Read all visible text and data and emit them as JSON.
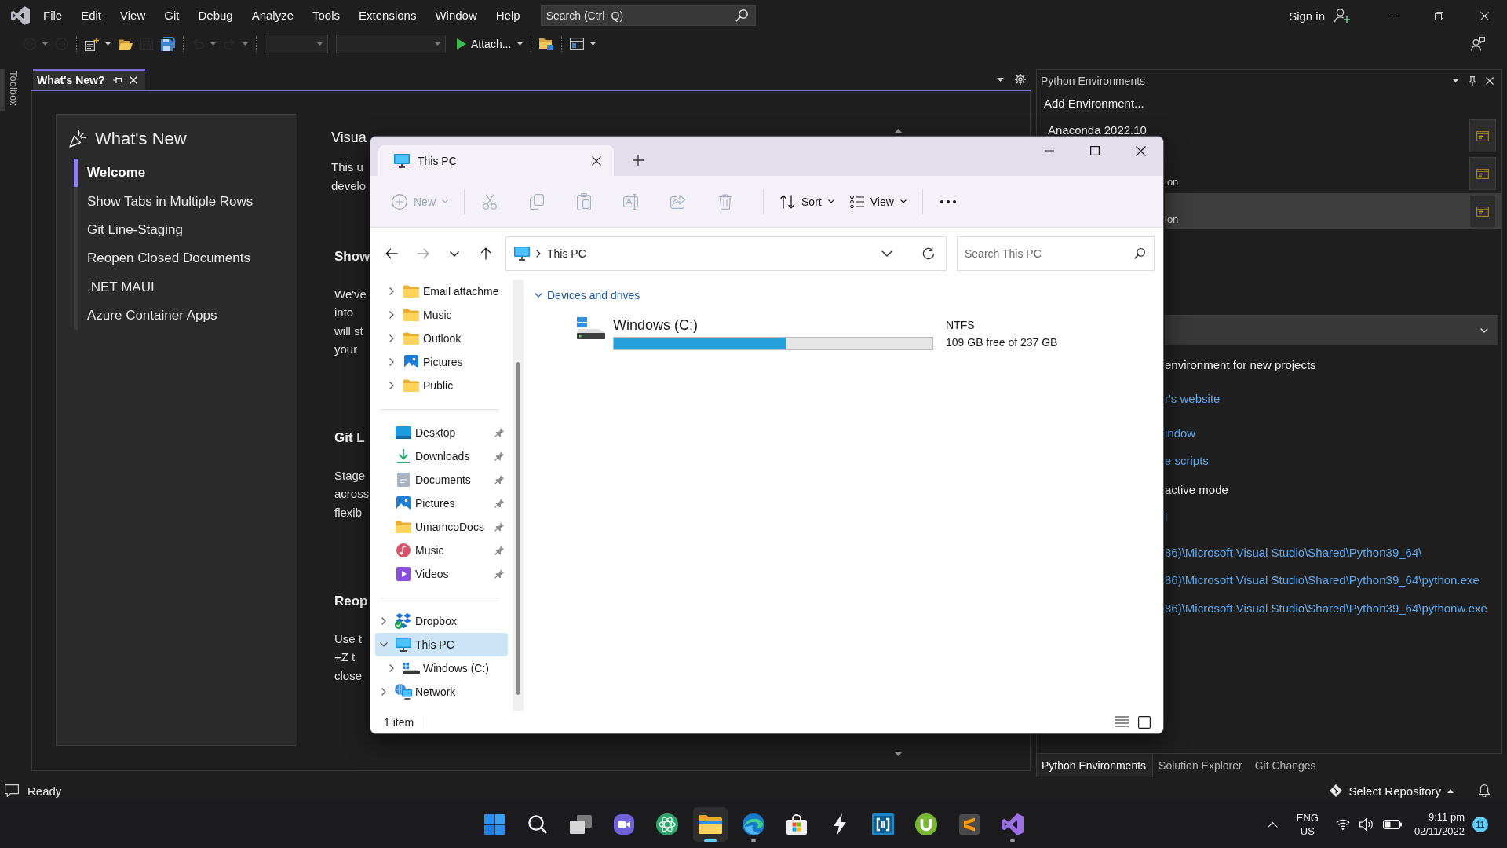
{
  "vs": {
    "menu": [
      "File",
      "Edit",
      "View",
      "Git",
      "Debug",
      "Analyze",
      "Tools",
      "Extensions",
      "Window",
      "Help"
    ],
    "search": {
      "placeholder": "Search (Ctrl+Q)"
    },
    "sign_in": "Sign in",
    "toolbar_groups": [
      [
        {
          "kind": "back",
          "disabled": true,
          "dropdown": true
        },
        {
          "kind": "forward",
          "disabled": true,
          "dropdown": false
        }
      ],
      [
        {
          "kind": "new-project",
          "disabled": false,
          "dropdown": true
        },
        {
          "kind": "open",
          "disabled": false,
          "dropdown": false
        },
        {
          "kind": "save",
          "disabled": true,
          "dropdown": false
        },
        {
          "kind": "save-all",
          "disabled": false,
          "dropdown": false
        }
      ],
      [
        {
          "kind": "undo",
          "disabled": true,
          "dropdown": true
        },
        {
          "kind": "redo",
          "disabled": true,
          "dropdown": true
        }
      ],
      [
        {
          "kind": "combo",
          "disabled": true,
          "dropdown": true
        },
        {
          "kind": "wide-combo",
          "disabled": true,
          "dropdown": true
        },
        {
          "kind": "start",
          "label": "Attach...",
          "disabled": false,
          "dropdown": true
        }
      ],
      [
        {
          "kind": "open-folder",
          "disabled": false,
          "dropdown": false
        }
      ],
      [
        {
          "kind": "layout",
          "disabled": false,
          "dropdown": true
        }
      ]
    ],
    "toolbox": "Toolbox",
    "doc_tabs": [
      {
        "label": "What's New?",
        "selected": true
      }
    ],
    "whats_new": {
      "title": "What's New",
      "items": [
        {
          "label": "Welcome",
          "selected": true
        },
        {
          "label": "Show Tabs in Multiple Rows",
          "selected": false
        },
        {
          "label": "Git Line-Staging",
          "selected": false
        },
        {
          "label": "Reopen Closed Documents",
          "selected": false
        },
        {
          "label": ".NET MAUI",
          "selected": false
        },
        {
          "label": "Azure Container Apps",
          "selected": false
        }
      ]
    },
    "article": {
      "title": "Visua",
      "intro": [
        "This u",
        "develo"
      ],
      "sections": [
        {
          "heading": "Show",
          "lines": [
            "We've",
            "into",
            "will st",
            "your"
          ]
        },
        {
          "heading": "Git L",
          "lines": [
            "Stage",
            "across",
            "flexib"
          ]
        },
        {
          "heading": "Reop",
          "lines": [
            "Use t",
            "+Z t",
            "close"
          ]
        }
      ]
    },
    "python_env": {
      "title": "Python Environments",
      "add": "Add Environment...",
      "environments": [
        {
          "name": "Anaconda 2022.10",
          "selected": false
        },
        {
          "detail": "ion",
          "selected": false
        },
        {
          "detail": "ion",
          "selected": true
        }
      ],
      "overview": [
        {
          "kind": "text",
          "text": "environment for new projects"
        },
        {
          "kind": "link",
          "text": "r's website"
        },
        {
          "kind": "link",
          "text": "indow"
        },
        {
          "kind": "link",
          "text": "e scripts"
        },
        {
          "kind": "text",
          "text": "active mode"
        },
        {
          "kind": "link",
          "text": "l"
        },
        {
          "kind": "link",
          "text": "86)\\Microsoft Visual Studio\\Shared\\Python39_64\\"
        },
        {
          "kind": "link",
          "text": "86)\\Microsoft Visual Studio\\Shared\\Python39_64\\python.exe"
        },
        {
          "kind": "link",
          "text": "86)\\Microsoft Visual Studio\\Shared\\Python39_64\\pythonw.exe"
        }
      ],
      "tabs": [
        {
          "label": "Python Environments",
          "selected": true
        },
        {
          "label": "Solution Explorer",
          "selected": false
        },
        {
          "label": "Git Changes",
          "selected": false
        }
      ]
    },
    "status": {
      "text": "Ready",
      "repo": "Select Repository"
    }
  },
  "explorer": {
    "tabs": [
      {
        "label": "This PC",
        "selected": true
      }
    ],
    "command_groups": [
      [
        {
          "kind": "new",
          "label": "New",
          "disabled": true,
          "dropdown": true
        }
      ],
      [
        {
          "kind": "cut",
          "disabled": true,
          "dropdown": false
        },
        {
          "kind": "copy",
          "disabled": true,
          "dropdown": false
        },
        {
          "kind": "paste",
          "disabled": true,
          "dropdown": false
        },
        {
          "kind": "rename",
          "disabled": true,
          "dropdown": false
        },
        {
          "kind": "share",
          "disabled": true,
          "dropdown": false
        },
        {
          "kind": "delete",
          "disabled": true,
          "dropdown": false
        }
      ],
      [
        {
          "kind": "sort",
          "label": "Sort",
          "disabled": false,
          "dropdown": true
        },
        {
          "kind": "view",
          "label": "View",
          "disabled": false,
          "dropdown": true
        }
      ],
      [
        {
          "kind": "more",
          "disabled": false,
          "dropdown": false
        }
      ]
    ],
    "nav_buttons": [
      {
        "kind": "back",
        "disabled": false
      },
      {
        "kind": "forward",
        "disabled": true
      },
      {
        "kind": "recent",
        "disabled": false
      },
      {
        "kind": "up",
        "disabled": false
      }
    ],
    "address": [
      "This PC"
    ],
    "search": {
      "placeholder": "Search This PC"
    },
    "nav_pane": [
      {
        "items": [
          {
            "kind": "folder",
            "label": "Email attachme",
            "expanded": false,
            "selected": false
          },
          {
            "kind": "folder",
            "label": "Music",
            "expanded": false,
            "selected": false
          },
          {
            "kind": "folder",
            "label": "Outlook",
            "expanded": false,
            "selected": false
          },
          {
            "kind": "pictures",
            "label": "Pictures",
            "expanded": false,
            "selected": false
          },
          {
            "kind": "folder",
            "label": "Public",
            "expanded": false,
            "selected": false
          }
        ]
      },
      {
        "items": [
          {
            "kind": "desktop",
            "label": "Desktop",
            "pinned": true,
            "selected": false
          },
          {
            "kind": "downloads",
            "label": "Downloads",
            "pinned": true,
            "selected": false
          },
          {
            "kind": "documents",
            "label": "Documents",
            "pinned": true,
            "selected": false
          },
          {
            "kind": "pictures",
            "label": "Pictures",
            "pinned": true,
            "selected": false
          },
          {
            "kind": "folder",
            "label": "UmamcoDocs",
            "pinned": true,
            "selected": false
          },
          {
            "kind": "music",
            "label": "Music",
            "pinned": true,
            "selected": false
          },
          {
            "kind": "videos",
            "label": "Videos",
            "pinned": true,
            "selected": false
          }
        ]
      },
      {
        "items": [
          {
            "kind": "dropbox",
            "label": "Dropbox",
            "expanded": false,
            "selected": false
          },
          {
            "kind": "pc",
            "label": "This PC",
            "expanded": true,
            "selected": true,
            "children": [
              {
                "kind": "drive",
                "label": "Windows (C:)",
                "expanded": false,
                "selected": false
              }
            ]
          },
          {
            "kind": "network",
            "label": "Network",
            "expanded": false,
            "selected": false
          }
        ]
      }
    ],
    "groups": [
      {
        "label": "Devices and drives",
        "expanded": true,
        "drives": [
          {
            "name": "Windows (C:)",
            "level": 0.54,
            "file_system": "NTFS",
            "space": "109 GB free of 237 GB"
          }
        ]
      }
    ],
    "status": "1 item"
  },
  "taskbar": {
    "apps": [
      {
        "kind": "start",
        "running": false,
        "selected": false
      },
      {
        "kind": "search",
        "running": false,
        "selected": false
      },
      {
        "kind": "task-view",
        "running": false,
        "selected": false
      },
      {
        "kind": "chat",
        "running": false,
        "selected": false
      },
      {
        "kind": "atom",
        "running": false,
        "selected": false
      },
      {
        "kind": "folder",
        "running": true,
        "selected": true
      },
      {
        "kind": "swirl",
        "running": true,
        "selected": false
      },
      {
        "kind": "bag",
        "running": false,
        "selected": false
      },
      {
        "kind": "bolt",
        "running": false,
        "selected": false
      },
      {
        "kind": "bracket",
        "running": false,
        "selected": false
      },
      {
        "kind": "u-circle",
        "running": false,
        "selected": false
      },
      {
        "kind": "s-tile",
        "running": false,
        "selected": false
      },
      {
        "kind": "ribbon",
        "running": true,
        "selected": false
      }
    ],
    "language": [
      "ENG",
      "US"
    ],
    "time": "9:11 pm",
    "date": "02/11/2022",
    "notifications": "11"
  }
}
